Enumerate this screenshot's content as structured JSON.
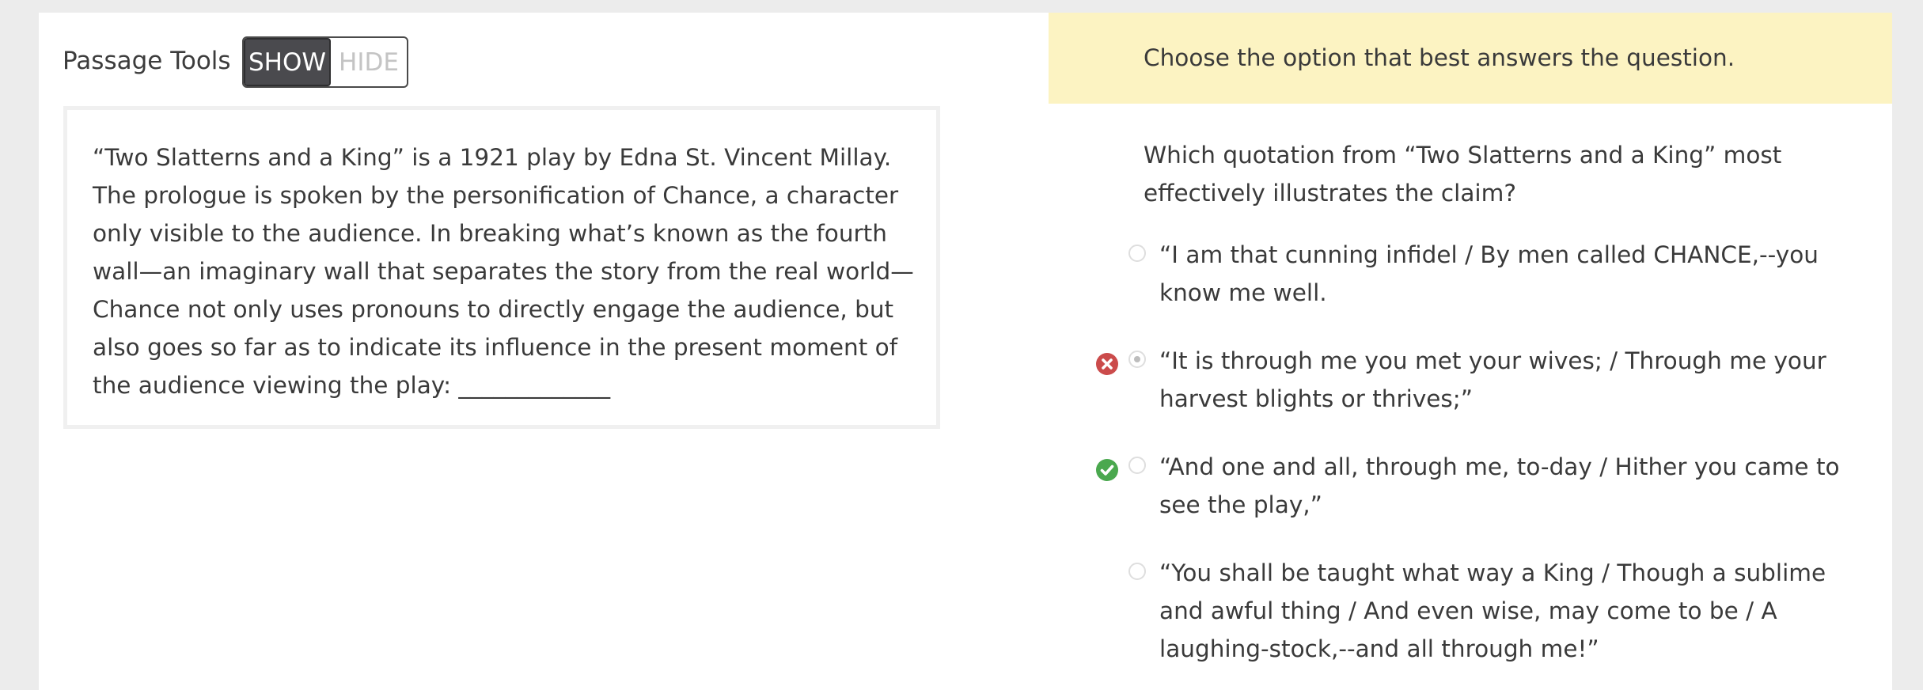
{
  "passage_tools": {
    "label": "Passage Tools",
    "show_label": "SHOW",
    "hide_label": "HIDE",
    "selected": "SHOW"
  },
  "passage": {
    "text": "“Two Slatterns and a King” is a 1921 play by Edna St. Vincent Millay. The prologue is spoken by the personification of Chance, a character only visible to the audience. In breaking what’s known as the fourth wall—an imaginary wall that separates the story from the real world—Chance not only uses pronouns to directly engage the audience, but also goes so far as to indicate its influence in the present moment of the audience viewing the play: _____________"
  },
  "instructions": "Choose the option that best answers the question.",
  "question": "Which quotation from “Two Slatterns and a King” most effectively illustrates the claim?",
  "options": [
    {
      "text": "“I am that cunning infidel / By men called CHANCE,--you know me well.",
      "selected": false,
      "status": "none"
    },
    {
      "text": "“It is through me you met your wives; / Through me your harvest blights or thrives;”",
      "selected": true,
      "status": "incorrect",
      "status_icon": "x-circle-icon"
    },
    {
      "text": "“And one and all, through me, to-day / Hither you came to see the play,”",
      "selected": false,
      "status": "correct",
      "status_icon": "check-circle-icon"
    },
    {
      "text": "“You shall be taught what way a King / Though a sublime and awful thing / And even wise, may come to be / A laughing-stock,--and all through me!”",
      "selected": false,
      "status": "none"
    }
  ],
  "colors": {
    "instruction_bar": "#fcf3c2",
    "incorrect": "#cb4b4b",
    "correct": "#4aa84e",
    "toggle_active": "#4a4a4e"
  }
}
